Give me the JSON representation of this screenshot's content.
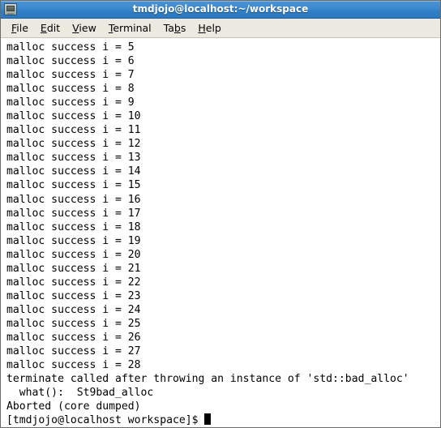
{
  "window": {
    "title": "tmdjojo@localhost:~/workspace",
    "icon": "terminal-icon"
  },
  "menubar": {
    "items": [
      {
        "label": "File",
        "mnemonic": "F",
        "name": "menu-file"
      },
      {
        "label": "Edit",
        "mnemonic": "E",
        "name": "menu-edit"
      },
      {
        "label": "View",
        "mnemonic": "V",
        "name": "menu-view"
      },
      {
        "label": "Terminal",
        "mnemonic": "T",
        "name": "menu-terminal"
      },
      {
        "label": "Tabs",
        "mnemonic": "b",
        "name": "menu-tabs"
      },
      {
        "label": "Help",
        "mnemonic": "H",
        "name": "menu-help"
      }
    ]
  },
  "terminal": {
    "background_color": "#ffffff",
    "foreground_color": "#000000",
    "cursor": "block",
    "prompt": "[tmdjojo@localhost workspace]$ ",
    "lines": [
      "malloc success i = 5",
      "malloc success i = 6",
      "malloc success i = 7",
      "malloc success i = 8",
      "malloc success i = 9",
      "malloc success i = 10",
      "malloc success i = 11",
      "malloc success i = 12",
      "malloc success i = 13",
      "malloc success i = 14",
      "malloc success i = 15",
      "malloc success i = 16",
      "malloc success i = 17",
      "malloc success i = 18",
      "malloc success i = 19",
      "malloc success i = 20",
      "malloc success i = 21",
      "malloc success i = 22",
      "malloc success i = 23",
      "malloc success i = 24",
      "malloc success i = 25",
      "malloc success i = 26",
      "malloc success i = 27",
      "malloc success i = 28",
      "terminate called after throwing an instance of 'std::bad_alloc'",
      "  what():  St9bad_alloc",
      "Aborted (core dumped)"
    ]
  },
  "colors": {
    "titlebar_top": "#4b93d4",
    "titlebar_bottom": "#2d79bf",
    "menubar_bg": "#ece9e1",
    "window_border": "#6d6b66"
  }
}
